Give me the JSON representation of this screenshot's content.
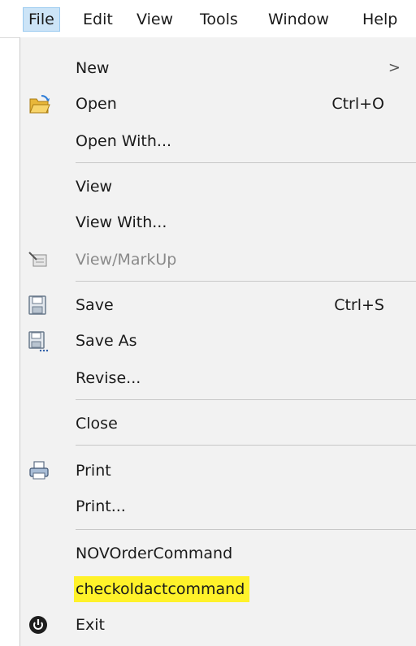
{
  "menubar": {
    "items": [
      "File",
      "Edit",
      "View",
      "Tools",
      "Window",
      "Help"
    ]
  },
  "file_menu": {
    "new": {
      "label": "New",
      "arrow": ">"
    },
    "open": {
      "label": "Open",
      "shortcut": "Ctrl+O"
    },
    "open_with": {
      "label": "Open With..."
    },
    "view": {
      "label": "View"
    },
    "view_with": {
      "label": "View With..."
    },
    "view_markup": {
      "label": "View/MarkUp"
    },
    "save": {
      "label": "Save",
      "shortcut": "Ctrl+S"
    },
    "save_as": {
      "label": "Save As"
    },
    "revise": {
      "label": "Revise..."
    },
    "close": {
      "label": "Close"
    },
    "print": {
      "label": "Print"
    },
    "print_dialog": {
      "label": "Print..."
    },
    "nov_order_command": {
      "label": "NOVOrderCommand"
    },
    "checkoldact_command": {
      "label": "checkoldactcommand"
    },
    "exit": {
      "label": "Exit"
    }
  },
  "colors": {
    "active_menubar_bg": "#cce4f7",
    "highlight": "#fff22a",
    "menu_bg": "#f2f2f2"
  }
}
